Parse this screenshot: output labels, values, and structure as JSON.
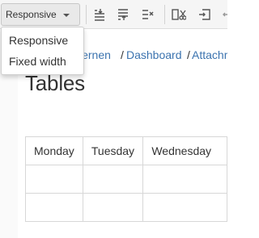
{
  "toolbar": {
    "width_select": {
      "selected": "Responsive"
    },
    "icons": [
      "insert-row-above-icon",
      "insert-row-below-icon",
      "delete-row-icon",
      "cut-row-icon",
      "copy-row-icon",
      "paste-row-icon"
    ]
  },
  "dropdown": {
    "options": [
      "Responsive",
      "Fixed width"
    ]
  },
  "breadcrumb": {
    "items": [
      "lernen",
      "Dashboard",
      "Attachm"
    ],
    "separator": "/"
  },
  "page": {
    "title": "Tables"
  },
  "table": {
    "headers": [
      "Monday",
      "Tuesday",
      "Wednesday"
    ],
    "rows": [
      [
        "",
        "",
        ""
      ],
      [
        "",
        "",
        ""
      ]
    ]
  },
  "colors": {
    "link": "#3b73af",
    "toolbar_bg": "#f5f5f5",
    "table_border": "#d7d7d7"
  }
}
